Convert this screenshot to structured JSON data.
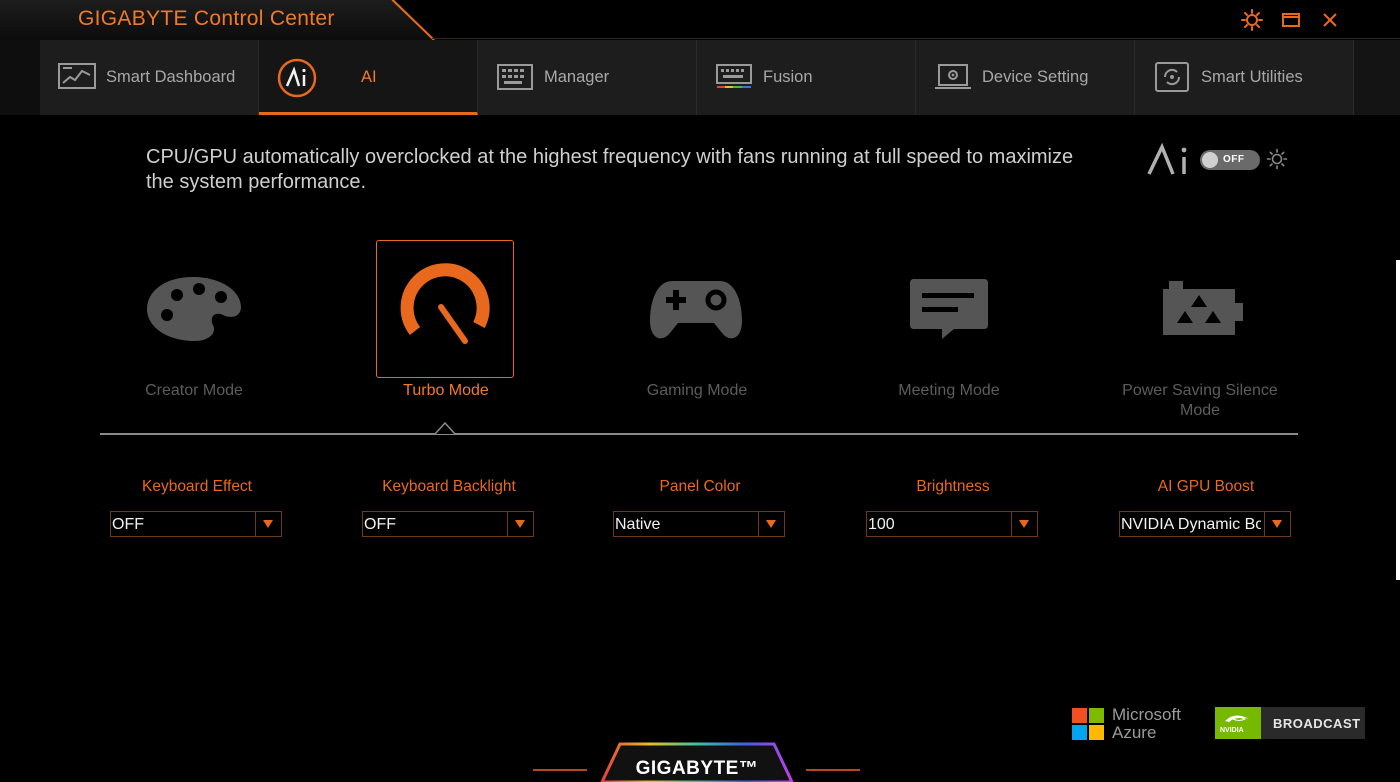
{
  "window": {
    "title": "GIGABYTE Control Center"
  },
  "tabs": [
    {
      "label": "Smart Dashboard",
      "icon": "dashboard-icon",
      "active": false
    },
    {
      "label": "AI",
      "icon": "ai-icon",
      "active": true
    },
    {
      "label": "Manager",
      "icon": "keyboard-manager-icon",
      "active": false
    },
    {
      "label": "Fusion",
      "icon": "rgb-keyboard-icon",
      "active": false
    },
    {
      "label": "Device Setting",
      "icon": "laptop-settings-icon",
      "active": false
    },
    {
      "label": "Smart Utilities",
      "icon": "utilities-icon",
      "active": false
    }
  ],
  "description": "CPU/GPU automatically overclocked at the highest frequency with fans running at full speed to maximize the system performance.",
  "ai_toggle": {
    "state": "OFF"
  },
  "modes": [
    {
      "label": "Creator Mode",
      "icon": "palette-icon",
      "active": false
    },
    {
      "label": "Turbo Mode",
      "icon": "speedometer-icon",
      "active": true
    },
    {
      "label": "Gaming Mode",
      "icon": "gamepad-icon",
      "active": false
    },
    {
      "label": "Meeting Mode",
      "icon": "chat-bubble-icon",
      "active": false
    },
    {
      "label": "Power Saving Silence Mode",
      "icon": "recycle-battery-icon",
      "active": false
    }
  ],
  "settings": [
    {
      "label": "Keyboard Effect",
      "value": "OFF"
    },
    {
      "label": "Keyboard Backlight",
      "value": "OFF"
    },
    {
      "label": "Panel Color",
      "value": "Native"
    },
    {
      "label": "Brightness",
      "value": "100"
    },
    {
      "label": "AI GPU Boost",
      "value": "NVIDIA Dynamic Bo"
    }
  ],
  "logos": {
    "azure_line1": "Microsoft",
    "azure_line2": "Azure",
    "nvidia_badge": "NVIDIA",
    "nvidia_text": "BROADCAST"
  },
  "brand": "GIGABYTE™",
  "colors": {
    "accent": "#e8691d",
    "background": "#000000",
    "inactive": "#5c5c5c"
  }
}
